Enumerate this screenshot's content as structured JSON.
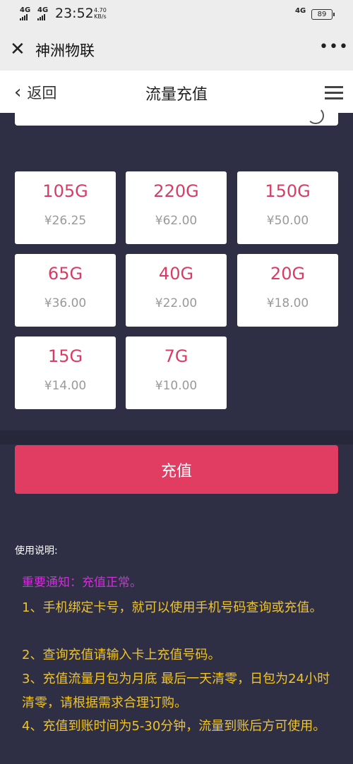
{
  "status_bar": {
    "network_1": "4G",
    "network_2": "4G",
    "time": "23:52",
    "speed_value": "4.70",
    "speed_unit": "KB/s",
    "right_network": "4G",
    "battery": "89"
  },
  "wechat_bar": {
    "title": "神洲物联",
    "close_icon": "close-icon",
    "more_icon": "more-icon"
  },
  "nav": {
    "back_label": "返回",
    "title": "流量充值",
    "menu_icon": "hamburger-menu-icon"
  },
  "packages": [
    {
      "data": "105G",
      "price": "¥26.25"
    },
    {
      "data": "220G",
      "price": "¥62.00"
    },
    {
      "data": "150G",
      "price": "¥50.00"
    },
    {
      "data": "65G",
      "price": "¥36.00"
    },
    {
      "data": "40G",
      "price": "¥22.00"
    },
    {
      "data": "20G",
      "price": "¥18.00"
    },
    {
      "data": "15G",
      "price": "¥14.00"
    },
    {
      "data": "7G",
      "price": "¥10.00"
    }
  ],
  "submit_label": "充值",
  "instructions": {
    "title": "使用说明:",
    "notice": "重要通知：充值正常。",
    "rules": [
      "1、手机绑定卡号，就可以使用手机号码查询或充值。",
      "2、查询充值请输入卡上充值号码。",
      "3、充值流量月包为月底 最后一天清零，日包为24小时清零，请根据需求合理订购。",
      "4、充值到账时间为5-30分钟，流量到账后方可使用。"
    ]
  },
  "colors": {
    "background": "#2e2e44",
    "accent": "#e13c62",
    "package_text": "#d83c64",
    "notice": "#d030d8",
    "rules": "#f0c428"
  }
}
